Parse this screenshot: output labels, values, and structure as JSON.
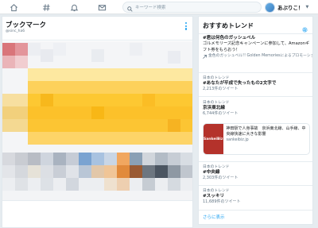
{
  "search": {
    "placeholder": "キーワード検索"
  },
  "user": {
    "name": "あぷりこ！"
  },
  "nav": {
    "icons": [
      "home-icon",
      "explore-icon",
      "notifications-icon",
      "messages-icon",
      "search-icon"
    ]
  },
  "bookmarks": {
    "title": "ブックマーク",
    "handle": "@sinc_ha6"
  },
  "trends": {
    "title": "おすすめトレンド",
    "more_label": "さらに表示",
    "items": [
      {
        "name": "#君は何色のガッシュベル",
        "desc": "ゴルメモリーズ記念キャンペーンに参加して、Amazonギフト券をもらおう！",
        "promo": "金色のガッシュベル!! Golden Memoriesによるプロモーション"
      },
      {
        "label": "日本のトレンド",
        "name": "#あなたが平成で失ったもの2文字で",
        "count": "2,213件のツイート"
      },
      {
        "label": "日本のトレンド",
        "name": "京浜東北線",
        "count": "6,744件のツイート"
      },
      {
        "label": "日本のトレンド",
        "name": "#中央線",
        "count": "2,303件のツイート"
      },
      {
        "label": "日本のトレンド",
        "name": "#スッキリ",
        "count": "11,689件のツイート"
      }
    ],
    "card": {
      "thumb_text": "SankeiBiz",
      "text": "神田駅で人身事故　京浜東北線、山手線、中央線快速に大きな影響",
      "url": "sankeibiz.jp"
    }
  },
  "colors": {
    "accent": "#1da1f2",
    "background": "#e6ecf0",
    "card_thumb": "#b4322b"
  }
}
